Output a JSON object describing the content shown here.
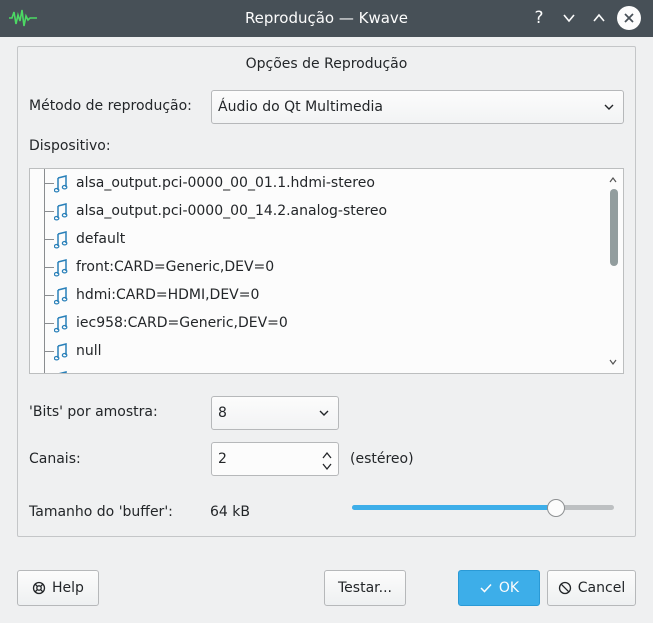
{
  "window": {
    "title": "Reprodução — Kwave",
    "help_glyph": "?"
  },
  "group": {
    "title": "Opções de Reprodução"
  },
  "method": {
    "label": "Método de reprodução:",
    "value": "Áudio do Qt Multimedia"
  },
  "device": {
    "label": "Dispositivo:",
    "items": [
      "alsa_output.pci-0000_00_01.1.hdmi-stereo",
      "alsa_output.pci-0000_00_14.2.analog-stereo",
      "default",
      "front:CARD=Generic,DEV=0",
      "hdmi:CARD=HDMI,DEV=0",
      "iec958:CARD=Generic,DEV=0",
      "null"
    ]
  },
  "bits": {
    "label": "'Bits' por amostra:",
    "value": "8"
  },
  "channels": {
    "label": "Canais:",
    "value": "2",
    "description": "(estéreo)"
  },
  "buffer": {
    "label": "Tamanho do 'buffer':",
    "value": "64 kB",
    "slider_fraction": 0.78
  },
  "buttons": {
    "help": "Help",
    "test": "Testar...",
    "ok": "OK",
    "cancel": "Cancel"
  },
  "colors": {
    "accent": "#3daee9",
    "titlebar": "#475057",
    "icon_blue": "#2980b9"
  }
}
